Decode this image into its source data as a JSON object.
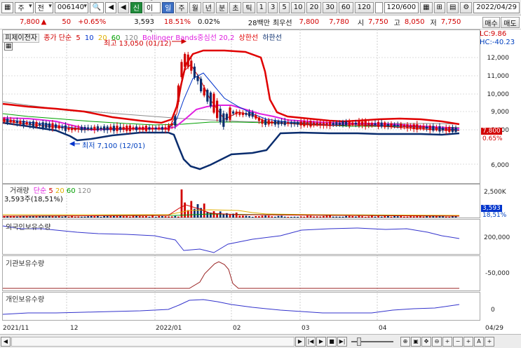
{
  "toolbar": {
    "market": "주",
    "type": "전",
    "code": "006140",
    "badge_new": "신",
    "name": "피제이전자",
    "periods": [
      "일",
      "주",
      "월",
      "년",
      "분",
      "초",
      "틱"
    ],
    "active_period": "일",
    "intervals": [
      "1",
      "3",
      "5",
      "10",
      "20",
      "30",
      "60",
      "120"
    ],
    "count": "120/600",
    "date": "2022/04/29"
  },
  "quote": {
    "price": "7,800",
    "change": "50",
    "change_pct": "+0.65%",
    "volume": "3,593",
    "turnover_pct": "18.51%",
    "small_pct": "0.02%",
    "amount": "28백만",
    "best_label": "최우선",
    "ask": "7,800",
    "bid": "7,780",
    "open_label": "시",
    "open": "7,750",
    "high_label": "고",
    "high": "8,050",
    "low_label": "저",
    "low": "7,750",
    "buy": "매수",
    "sell": "매도"
  },
  "legend": {
    "name": "피제이전자",
    "ma_prefix": "종가 단순",
    "ma5": "5",
    "ma10": "10",
    "ma20": "20",
    "ma60": "60",
    "ma120": "120",
    "bb": "Bollinger Bands중심선 20,2",
    "bb_upper": "상한선",
    "bb_lower": "하한선",
    "lc": "LC:9.86",
    "hc": "HC:-40.23",
    "max_note": "최고 13,050 (01/12)",
    "min_note": "최저 7,100 (12/01)",
    "last_price": "7,800",
    "last_pct": "0.65%"
  },
  "volume_pane": {
    "label": "거래량",
    "ma_prefix": "단순",
    "ma5": "5",
    "ma20": "20",
    "ma60": "60",
    "ma120": "120",
    "current": "3,593주(18,51%)",
    "tag": "3,593",
    "tag_pct": "18,51%",
    "axis_label": "2,500K"
  },
  "foreign_pane": {
    "label": "외국인보유수량",
    "axis_label": "200,000"
  },
  "inst_pane": {
    "label": "기관보유수량",
    "axis_label": "-50,000"
  },
  "indiv_pane": {
    "label": "개인보유수량",
    "axis_label": "0"
  },
  "price_axis": [
    "12,000",
    "11,000",
    "10,000",
    "9,000",
    "8,000",
    "6,000"
  ],
  "x_axis": [
    "2021/11",
    "12",
    "2022/01",
    "02",
    "03",
    "04",
    "04/29"
  ],
  "colors": {
    "up": "#d20000",
    "down": "#0a2d6e",
    "bb_upper": "#e00000",
    "bb_lower": "#0a2d6e",
    "bb_mid": "#e020e0",
    "ma5": "#d00000",
    "ma10": "#0033cc",
    "ma20": "#e0b000",
    "ma60": "#00a000",
    "ma120": "#888888",
    "foreign": "#3333cc",
    "inst": "#992222",
    "indiv": "#3333cc"
  }
}
